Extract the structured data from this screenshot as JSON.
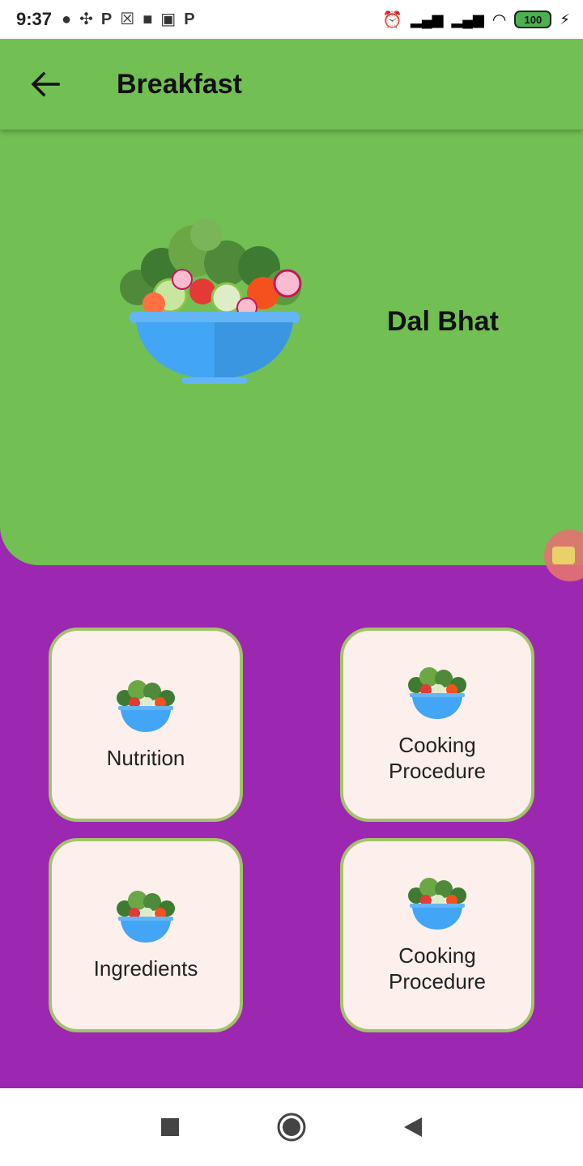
{
  "status_bar": {
    "time": "9:37",
    "battery_level": "100"
  },
  "app_bar": {
    "title": "Breakfast"
  },
  "hero": {
    "dish_name": "Dal Bhat"
  },
  "cards": [
    {
      "label": "Nutrition"
    },
    {
      "label": "Cooking Procedure"
    },
    {
      "label": "Ingredients"
    },
    {
      "label": "Cooking Procedure"
    }
  ],
  "colors": {
    "app_green": "#72BF53",
    "background_purple": "#9C27B0",
    "card_fill": "#FCEFEC",
    "card_border": "#A3C36A",
    "bowl_blue": "#42A5F5"
  },
  "icons": {
    "back": "arrow-left-icon",
    "salad": "salad-bowl-icon",
    "nav_recents": "square-icon",
    "nav_home": "circle-icon",
    "nav_back": "triangle-back-icon"
  }
}
